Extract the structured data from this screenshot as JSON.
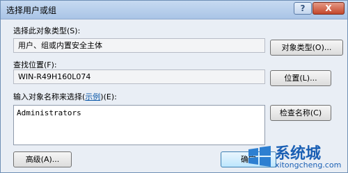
{
  "window": {
    "title": "选择用户或组",
    "help_label": "?",
    "close_label": "X"
  },
  "object_type": {
    "label": "选择此对象类型(S):",
    "value": "用户、组或内置安全主体",
    "button": "对象类型(O)..."
  },
  "location": {
    "label": "查找位置(F):",
    "value": "WIN-R49H160L074",
    "button": "位置(L)..."
  },
  "names": {
    "label_prefix": "输入对象名称来选择(",
    "label_link": "示例",
    "label_suffix": ")(E):",
    "value": "Administrators",
    "check_button": "检查名称(C)"
  },
  "footer": {
    "advanced_button": "高级(A)...",
    "ok_button": "确定"
  },
  "watermark": {
    "text": "系统城",
    "sub": "xitongcheng.com"
  },
  "colors": {
    "accent": "#1a5fb4",
    "link": "#0a57a8"
  }
}
